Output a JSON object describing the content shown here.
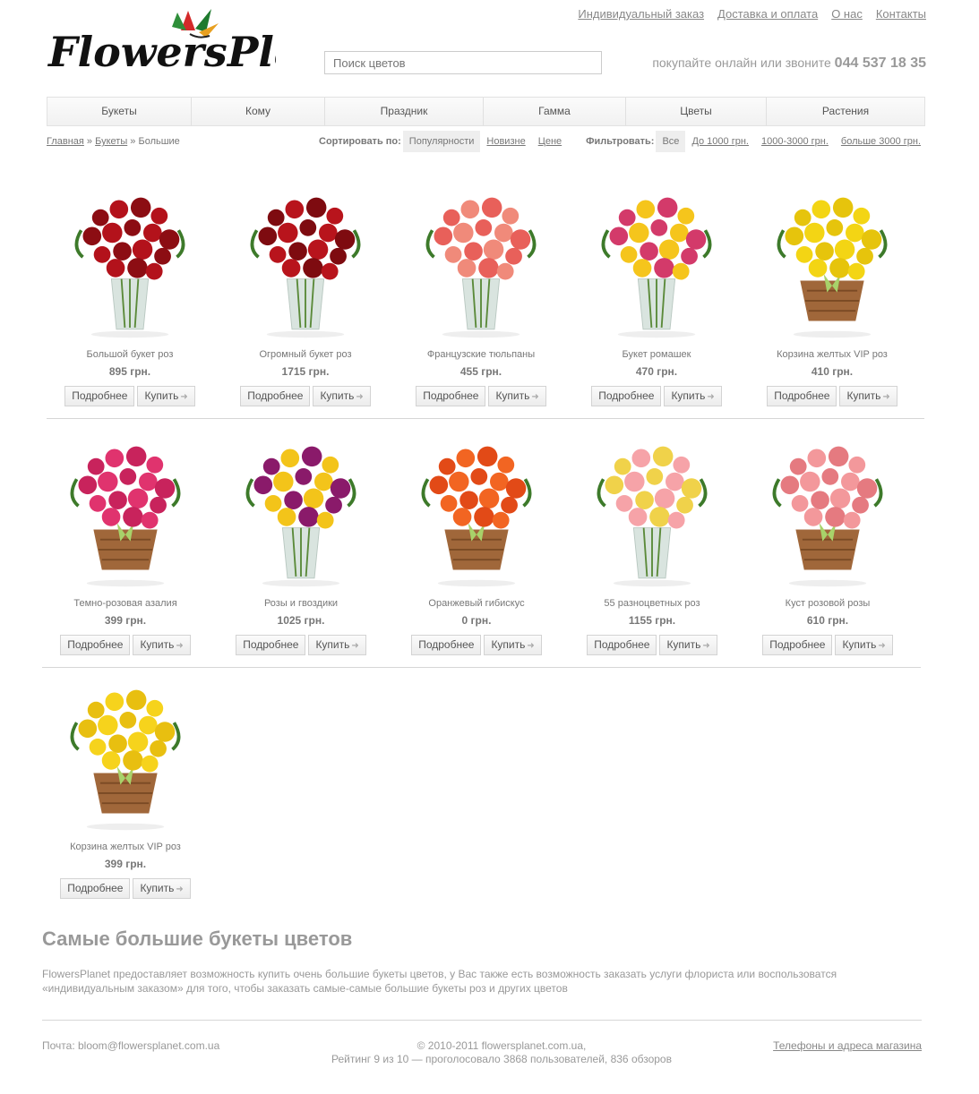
{
  "header": {
    "logo_text": "FlowersPlanet",
    "top_links": [
      "Индивидуальный заказ",
      "Доставка и оплата",
      "О нас",
      "Контакты"
    ],
    "search_placeholder": "Поиск цветов",
    "tagline": "покупайте онлайн или звоните",
    "phone": "044 537 18 35"
  },
  "nav": [
    "Букеты",
    "Кому",
    "Праздник",
    "Гамма",
    "Цветы",
    "Растения"
  ],
  "breadcrumb": {
    "home": "Главная",
    "sep1": " » ",
    "section": "Букеты",
    "sep2": " » ",
    "current": "Большие"
  },
  "sort": {
    "label": "Сортировать по:",
    "options": [
      "Популярности",
      "Новизне",
      "Цене"
    ],
    "active": 0
  },
  "filter": {
    "label": "Фильтровать:",
    "options": [
      "Все",
      "До 1000 грн.",
      "1000-3000 грн.",
      "больше 3000 грн."
    ],
    "active": 0
  },
  "buttons": {
    "details": "Подробнее",
    "buy": "Купить"
  },
  "products": [
    {
      "name": "Большой букет роз",
      "price": "895 грн.",
      "colors": [
        "#b3121b",
        "#8c0d13"
      ],
      "kind": "vase"
    },
    {
      "name": "Огромный букет роз",
      "price": "1715 грн.",
      "colors": [
        "#b8141c",
        "#7e0b10"
      ],
      "kind": "vase"
    },
    {
      "name": "Французские тюльпаны",
      "price": "455 грн.",
      "colors": [
        "#f08a7a",
        "#e8605a"
      ],
      "kind": "vase"
    },
    {
      "name": "Букет ромашек",
      "price": "470 грн.",
      "colors": [
        "#f5c51c",
        "#d33a6a"
      ],
      "kind": "vase"
    },
    {
      "name": "Корзина желтых VIP роз",
      "price": "410 грн.",
      "colors": [
        "#f3d514",
        "#e6c40c"
      ],
      "kind": "basket"
    },
    {
      "name": "Темно-розовая азалия",
      "price": "399 грн.",
      "colors": [
        "#e0336e",
        "#c8235c"
      ],
      "kind": "basket"
    },
    {
      "name": "Розы и гвоздики",
      "price": "1025 грн.",
      "colors": [
        "#f3c41a",
        "#8a1a6a"
      ],
      "kind": "vase"
    },
    {
      "name": "Оранжевый гибискус",
      "price": "0 грн.",
      "colors": [
        "#f26522",
        "#e24a17"
      ],
      "kind": "basket"
    },
    {
      "name": "55 разноцветных роз",
      "price": "1155 грн.",
      "colors": [
        "#f6a3a8",
        "#f0d24a"
      ],
      "kind": "vase"
    },
    {
      "name": "Куст розовой розы",
      "price": "610 грн.",
      "colors": [
        "#f3989b",
        "#e57a80"
      ],
      "kind": "basket"
    },
    {
      "name": "Корзина желтых VIP роз",
      "price": "399 грн.",
      "colors": [
        "#f6d31c",
        "#e8bf10"
      ],
      "kind": "basket"
    }
  ],
  "seo": {
    "title": "Самые большие букеты цветов",
    "text": "FlowersPlanet предоставляет возможность купить очень большие букеты цветов, у Вас также есть возможность заказать услуги флориста или воспользоватся «индивидуальным заказом» для того, чтобы заказать самые-самые большие букеты роз и других цветов"
  },
  "footer": {
    "email": "Почта: bloom@flowersplanet.com.ua",
    "copyright": "© 2010-2011 flowersplanet.com.ua,",
    "rating": "Рейтинг 9 из 10 — проголосовало 3868 пользователей, 836 обзоров",
    "stores_link": "Телефоны и адреса магазина"
  }
}
